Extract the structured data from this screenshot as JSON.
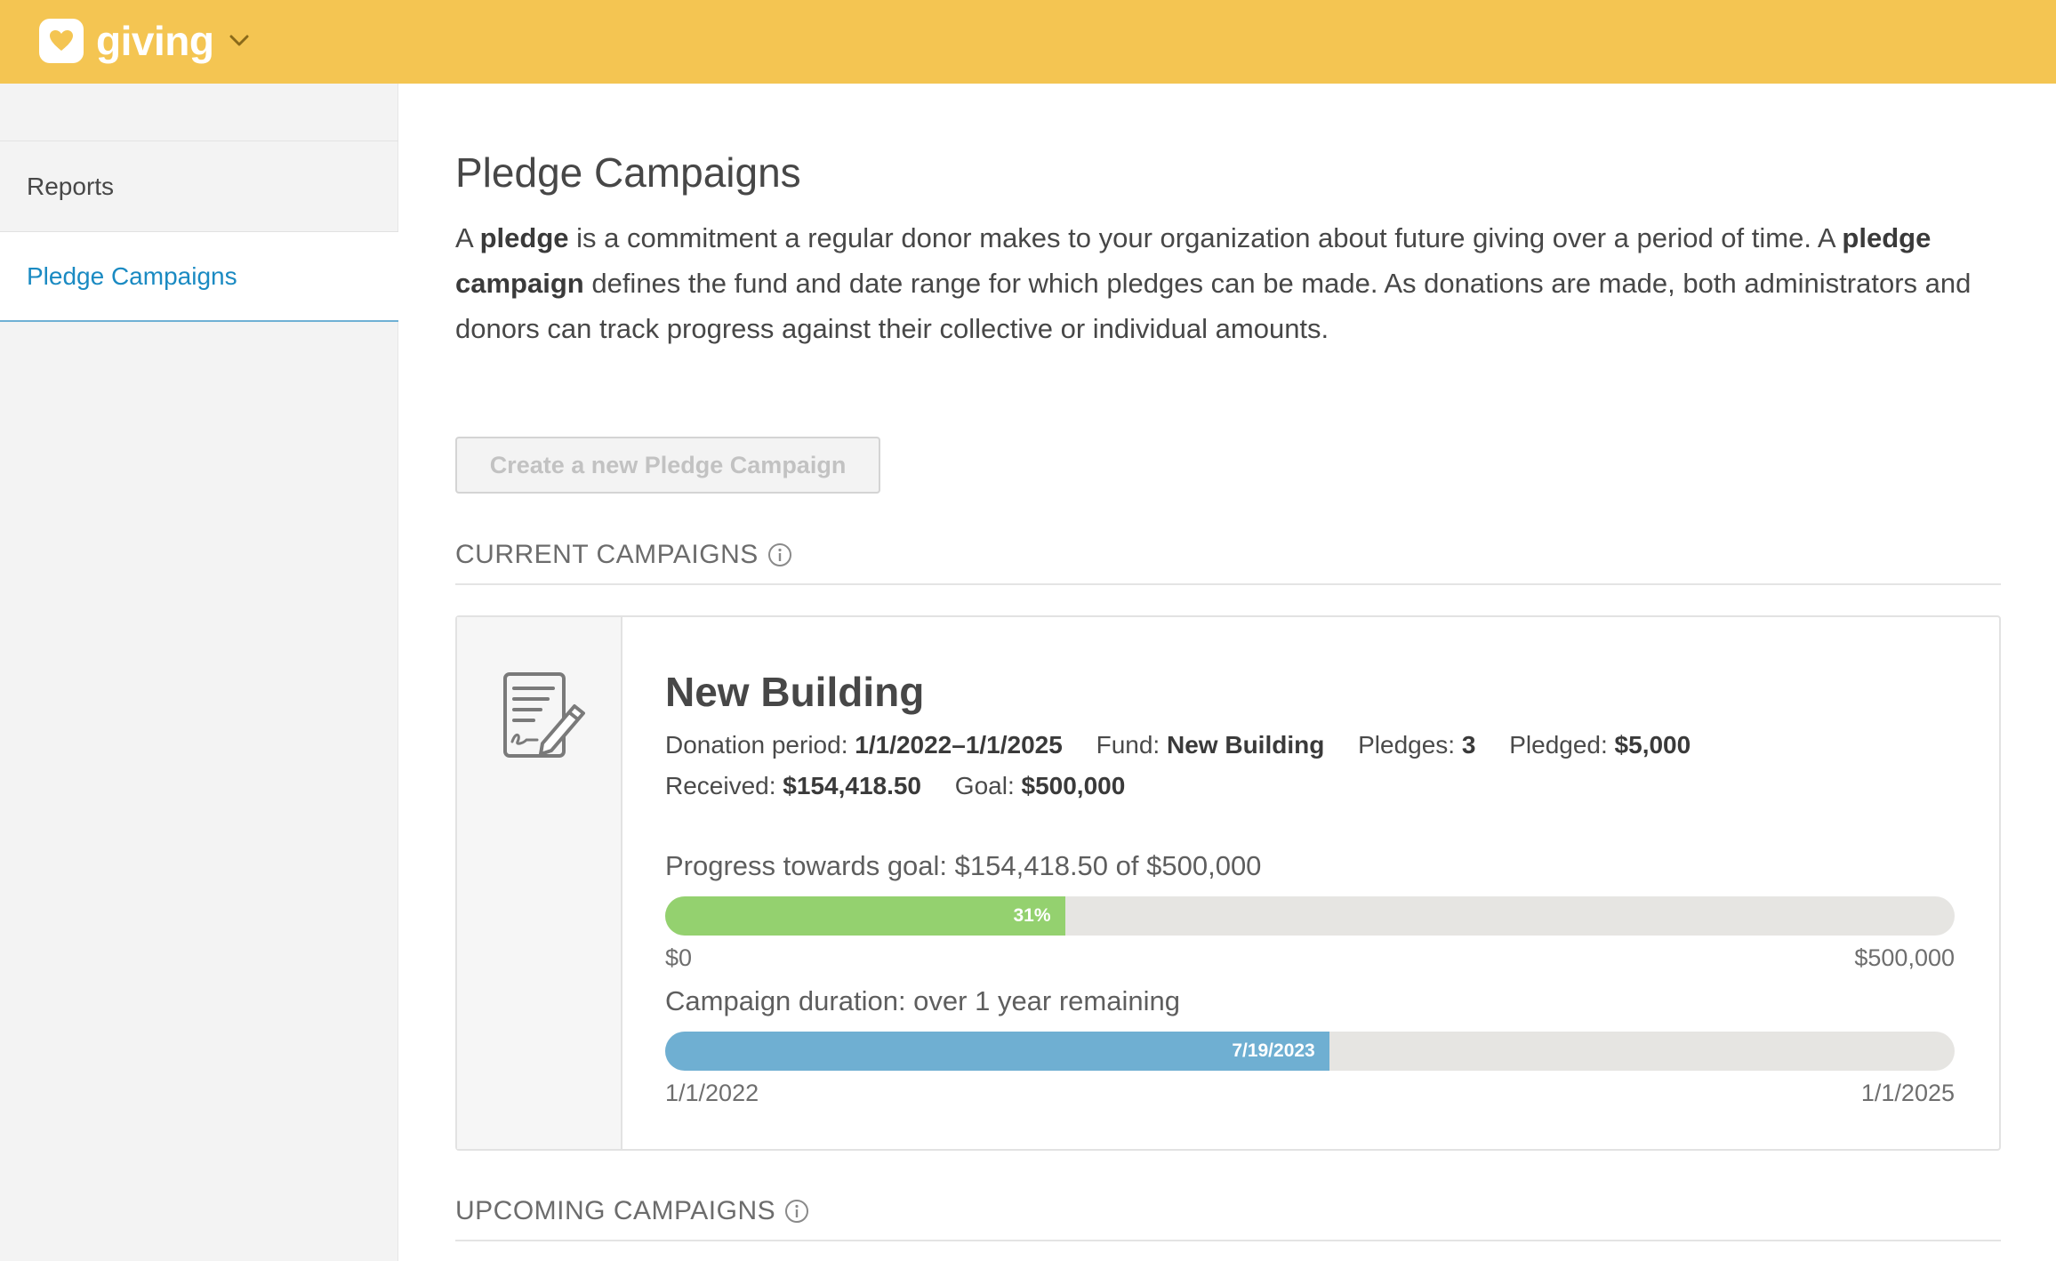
{
  "header": {
    "app_name": "giving",
    "bg_color": "#f4c552",
    "logo_icon": "heart-icon",
    "dropdown_icon": "chevron-down-icon"
  },
  "sidebar": {
    "items": [
      {
        "label": "Reports",
        "active": false
      },
      {
        "label": "Pledge Campaigns",
        "active": true
      }
    ],
    "active_color": "#1a8ac2"
  },
  "main": {
    "title": "Pledge Campaigns",
    "intro": {
      "p1": "A ",
      "b1": "pledge",
      "p2": " is a commitment a regular donor makes to your organization about future giving over a period of time. A ",
      "b2": "pledge campaign",
      "p3": " defines the fund and date range for which pledges can be made. As donations are made, both administrators and donors can track progress against their collective or individual amounts."
    },
    "create_button": {
      "label": "Create a new Pledge Campaign",
      "disabled": true
    },
    "sections": {
      "current": "CURRENT CAMPAIGNS",
      "upcoming": "UPCOMING CAMPAIGNS"
    },
    "campaign": {
      "name": "New Building",
      "icon": "pledge-document-icon",
      "donation_period_label": "Donation period:",
      "donation_period_value": "1/1/2022–1/1/2025",
      "fund_label": "Fund:",
      "fund_value": "New Building",
      "pledges_label": "Pledges:",
      "pledges_value": "3",
      "pledged_label": "Pledged:",
      "pledged_value": "$5,000",
      "received_label": "Received:",
      "received_value": "$154,418.50",
      "goal_label": "Goal:",
      "goal_value": "$500,000",
      "progress": {
        "label": "Progress towards goal: $154,418.50 of $500,000",
        "percent_text": "31%",
        "fraction": 0.31,
        "start": "$0",
        "end": "$500,000",
        "color": "#94d16f"
      },
      "duration": {
        "label": "Campaign duration: over 1 year remaining",
        "current_text": "7/19/2023",
        "fraction": 0.515,
        "start": "1/1/2022",
        "end": "1/1/2025",
        "color": "#6fafd2"
      }
    }
  }
}
